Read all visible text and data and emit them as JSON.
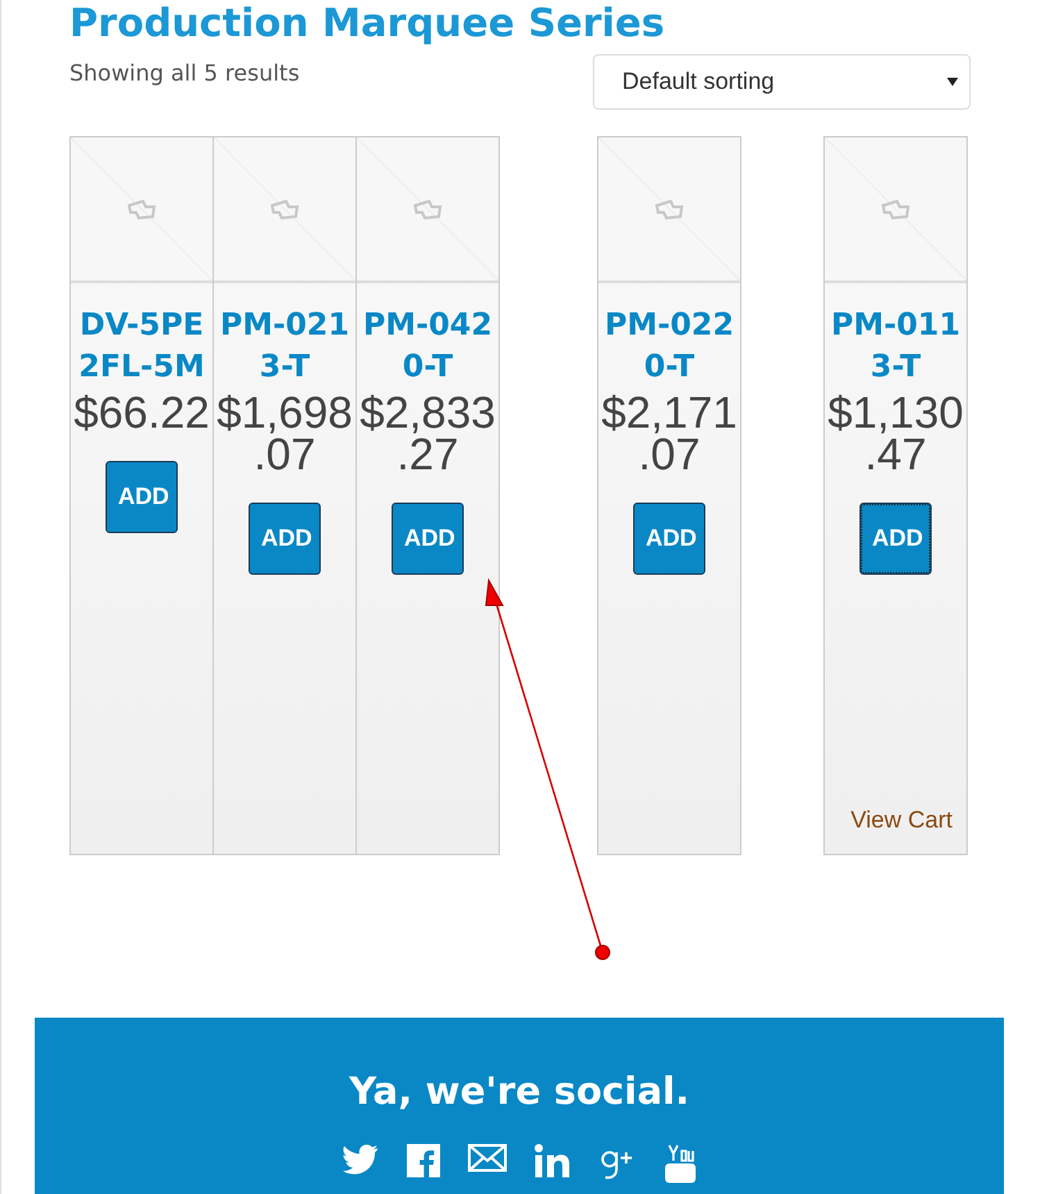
{
  "page_title": "Production Marquee Series",
  "result_count": "Showing all 5 results",
  "sorting": {
    "value": "Default sorting"
  },
  "products": [
    {
      "name": "DV-5PE2FL-5M",
      "price": "$66.22",
      "button": "ADD",
      "focused": false
    },
    {
      "name": "PM-0213-T",
      "price": "$1,698.07",
      "button": "ADD",
      "focused": false
    },
    {
      "name": "PM-0420-T",
      "price": "$2,833.27",
      "button": "ADD",
      "focused": false
    },
    {
      "name": "PM-0220-T",
      "price": "$2,171.07",
      "button": "ADD",
      "focused": false
    },
    {
      "name": "PM-0113-T",
      "price": "$1,130.47",
      "button": "ADD",
      "focused": true,
      "view_cart": "View Cart"
    }
  ],
  "footer": {
    "heading": "Ya, we're social."
  }
}
